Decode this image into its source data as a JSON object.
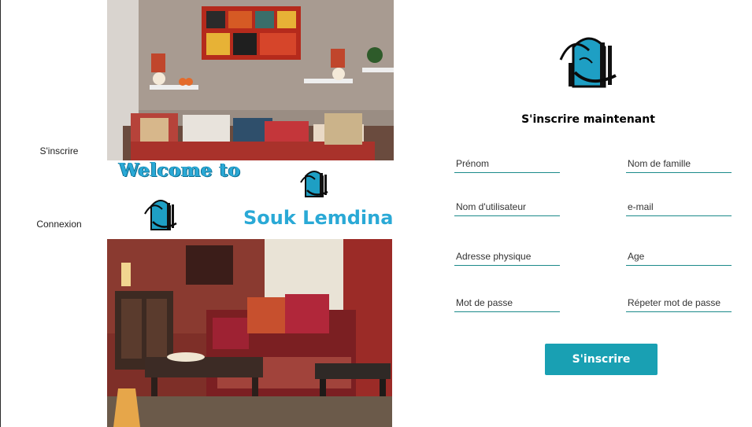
{
  "nav": {
    "signup_label": "S'inscrire",
    "login_label": "Connexion"
  },
  "hero": {
    "welcome_text": "Welcome to",
    "brand_name": "Souk Lemdina"
  },
  "form": {
    "title": "S'inscrire maintenant",
    "fields": {
      "first_name": "Prénom",
      "last_name": "Nom de famille",
      "username": "Nom d'utilisateur",
      "email": "e-mail",
      "address": "Adresse physique",
      "age": "Age",
      "password": "Mot de passe",
      "password_repeat": "Répeter mot de passe"
    },
    "submit_label": "S'inscrire"
  },
  "colors": {
    "accent": "#19a0b3",
    "brand_blue": "#2aa9d6",
    "field_underline": "#1b8a8a"
  }
}
